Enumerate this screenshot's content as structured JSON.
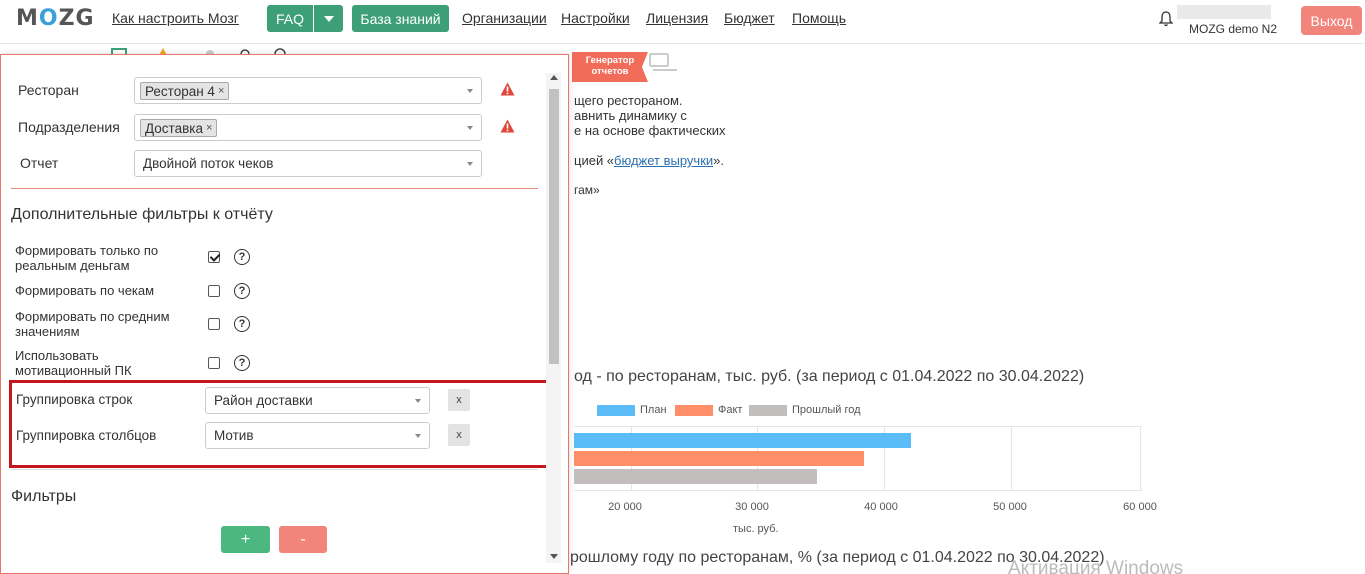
{
  "nav": {
    "logo": "MOZG",
    "links": [
      "Как настроить Мозг",
      "Организации",
      "Настройки",
      "Лицензия",
      "Бюджет",
      "Помощь"
    ],
    "faq_label": "FAQ",
    "kb_label": "База знаний",
    "user_name": "MOZG demo N2",
    "logout_label": "Выход"
  },
  "background": {
    "badge": "Генератор отчетов",
    "lines": [
      "щего рестораном.",
      "авнить динамику с",
      "е на основе фактических"
    ],
    "link_prefix": "цией «",
    "link_text": "бюджет выручки",
    "link_suffix": "».",
    "line5": "гам»",
    "chart_title": "од - по ресторанам, тыс. руб. (за период с 01.04.2022 по 30.04.2022)",
    "chart_title2": "рошлому году по ресторанам, % (за период с 01.04.2022 по 30.04.2022)",
    "watermark": "Активация Windows"
  },
  "chart_data": {
    "type": "bar",
    "orientation": "horizontal",
    "series": [
      {
        "name": "План",
        "color": "#5bbcf8",
        "value": 42200
      },
      {
        "name": "Факт",
        "color": "#fd8e68",
        "value": 38600
      },
      {
        "name": "Прошлый год",
        "color": "#c2bebe",
        "value": 34900
      }
    ],
    "x_ticks": [
      "20 000",
      "30 000",
      "40 000",
      "50 000",
      "60 000"
    ],
    "xlabel": "тыс. руб.",
    "legend_position": "top"
  },
  "panel": {
    "restaurant_label": "Ресторан",
    "restaurant_tag": "Ресторан 4",
    "division_label": "Подразделения",
    "division_tag": "Доставка",
    "report_label": "Отчет",
    "report_value": "Двойной поток чеков",
    "extra_title": "Дополнительные фильтры к отчёту",
    "options": [
      {
        "label": "Формировать только по реальным деньгам",
        "checked": true
      },
      {
        "label": "Формировать по чекам",
        "checked": false
      },
      {
        "label": "Формировать по средним значениям",
        "checked": false
      },
      {
        "label": "Использовать мотивационный ПК",
        "checked": false
      }
    ],
    "row_group_label": "Группировка строк",
    "row_group_value": "Район доставки",
    "col_group_label": "Группировка столбцов",
    "col_group_value": "Мотив",
    "clear": "x",
    "filters_title": "Фильтры",
    "plus": "+",
    "minus": "-",
    "help": "?",
    "tag_remove": "×"
  }
}
